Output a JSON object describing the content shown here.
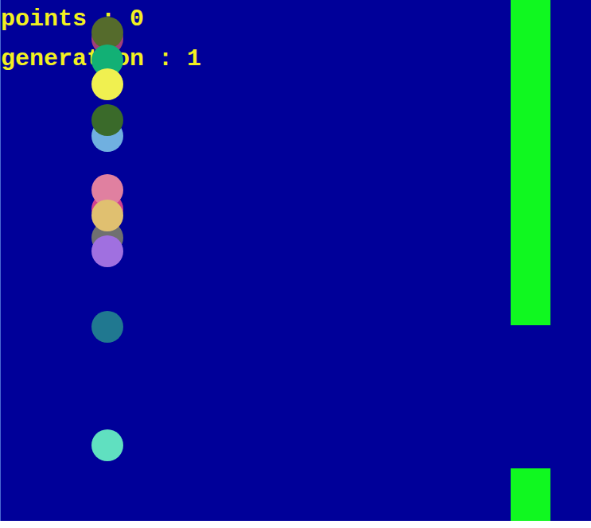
{
  "hud": {
    "points": "points : 0",
    "generation": "generation : 1"
  },
  "pipes": [
    {
      "gap_top": 0.625,
      "gap_bottom": 0.899
    }
  ],
  "birds": [
    {
      "level": 0.076,
      "color": "#a0407a"
    },
    {
      "level": 0.064,
      "color": "#556b2c"
    },
    {
      "level": 0.117,
      "color": "#12b075"
    },
    {
      "level": 0.163,
      "color": "#f0f050"
    },
    {
      "level": 0.262,
      "color": "#70b0e0"
    },
    {
      "level": 0.232,
      "color": "#3a6a2a"
    },
    {
      "level": 0.402,
      "color": "#d04090"
    },
    {
      "level": 0.366,
      "color": "#e080a0"
    },
    {
      "level": 0.457,
      "color": "#707070"
    },
    {
      "level": 0.415,
      "color": "#e0c070"
    },
    {
      "level": 0.483,
      "color": "#a070e0"
    },
    {
      "level": 0.628,
      "color": "#207890"
    },
    {
      "level": 0.855,
      "color": "#60e0c0"
    }
  ]
}
